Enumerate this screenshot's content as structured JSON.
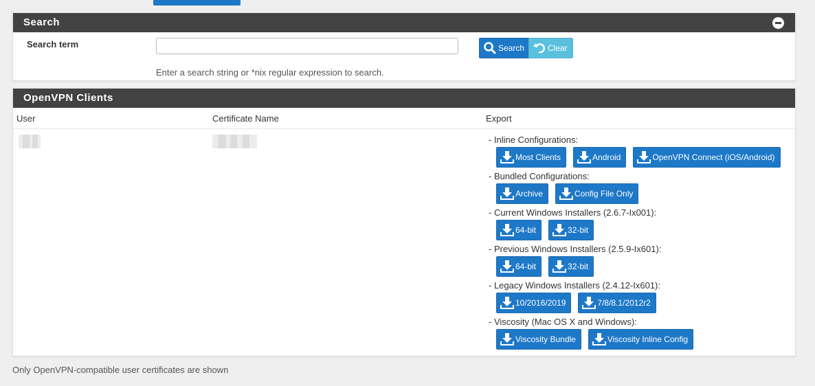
{
  "colors": {
    "primary": "#1e78c8",
    "info": "#5bc0de",
    "heading": "#424242"
  },
  "search": {
    "title": "Search",
    "term_label": "Search term",
    "input_value": "",
    "help": "Enter a search string or *nix regular expression to search.",
    "search_label": "Search",
    "clear_label": "Clear"
  },
  "clients": {
    "title": "OpenVPN Clients",
    "columns": {
      "user": "User",
      "cert": "Certificate Name",
      "export": "Export"
    },
    "groups": [
      {
        "label": "- Inline Configurations:",
        "buttons": [
          "Most Clients",
          "Android",
          "OpenVPN Connect (iOS/Android)"
        ]
      },
      {
        "label": "- Bundled Configurations:",
        "buttons": [
          "Archive",
          "Config File Only"
        ]
      },
      {
        "label": "- Current Windows Installers (2.6.7-Ix001):",
        "buttons": [
          "64-bit",
          "32-bit"
        ]
      },
      {
        "label": "- Previous Windows Installers (2.5.9-Ix601):",
        "buttons": [
          "64-bit",
          "32-bit"
        ]
      },
      {
        "label": "- Legacy Windows Installers (2.4.12-Ix601):",
        "buttons": [
          "10/2016/2019",
          "7/8/8.1/2012r2"
        ]
      },
      {
        "label": "- Viscosity (Mac OS X and Windows):",
        "buttons": [
          "Viscosity Bundle",
          "Viscosity Inline Config"
        ]
      }
    ]
  },
  "footer_note": "Only OpenVPN-compatible user certificates are shown"
}
